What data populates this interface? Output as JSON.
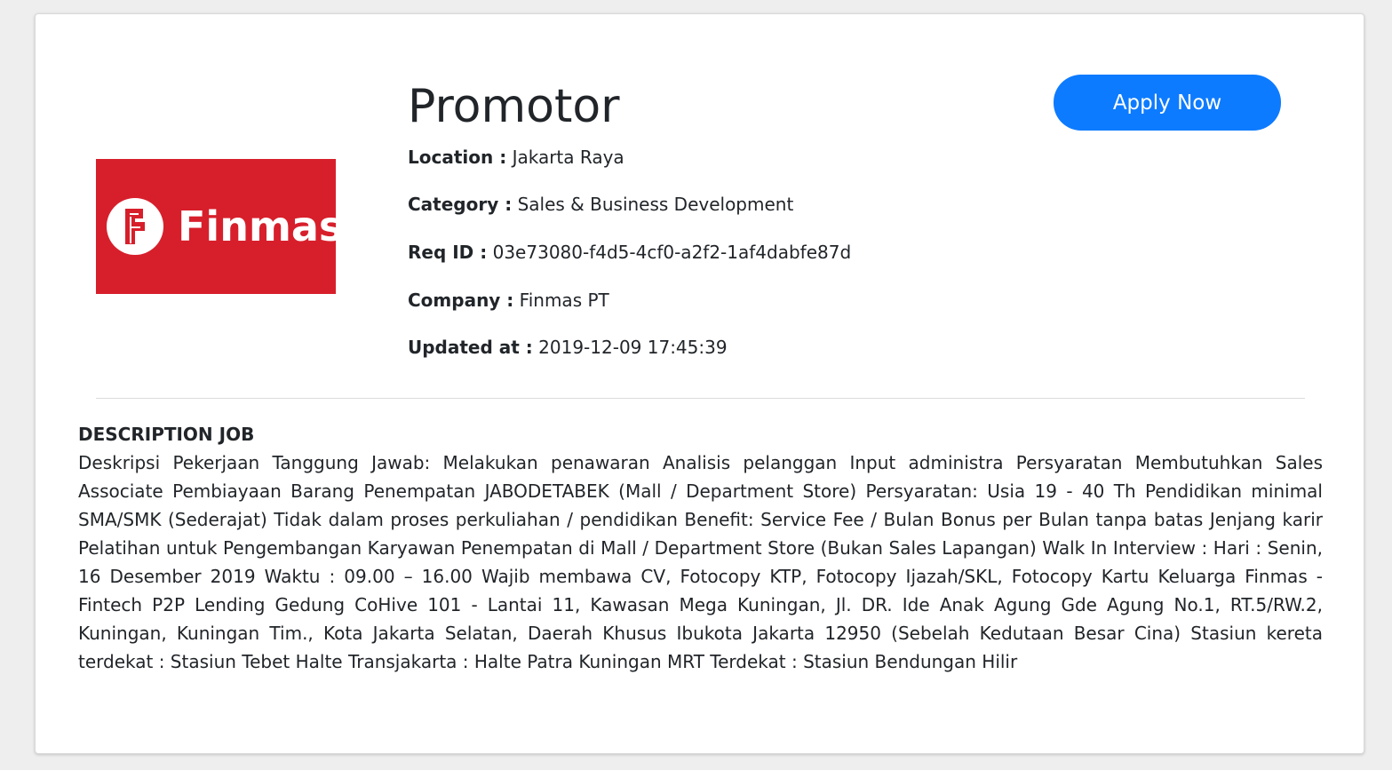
{
  "job": {
    "title": "Promotor",
    "apply_label": "Apply Now",
    "logo_text": "Finmas",
    "fields": {
      "location_label": "Location :",
      "location_value": "Jakarta Raya",
      "category_label": "Category :",
      "category_value": "Sales & Business Development",
      "reqid_label": "Req ID :",
      "reqid_value": "03e73080-f4d5-4cf0-a2f2-1af4dabfe87d",
      "company_label": "Company :",
      "company_value": "Finmas PT",
      "updated_label": "Updated at :",
      "updated_value": "2019-12-09 17:45:39"
    },
    "description_heading": "DESCRIPTION JOB",
    "description_text": "Deskripsi Pekerjaan Tanggung Jawab: Melakukan penawaran Analisis pelanggan Input administra Persyaratan Membutuhkan Sales Associate Pembiayaan Barang Penempatan JABODETABEK (Mall / Department Store) Persyaratan: Usia 19 - 40 Th Pendidikan minimal SMA/SMK (Sederajat) Tidak dalam proses perkuliahan / pendidikan Benefit: Service Fee / Bulan Bonus per Bulan tanpa batas Jenjang karir Pelatihan untuk Pengembangan Karyawan Penempatan di Mall / Department Store (Bukan Sales Lapangan) Walk In Interview : Hari : Senin, 16 Desember 2019 Waktu : 09.00 – 16.00 Wajib membawa CV, Fotocopy KTP, Fotocopy Ijazah/SKL, Fotocopy Kartu Keluarga Finmas - Fintech P2P Lending Gedung CoHive 101 - Lantai 11, Kawasan Mega Kuningan, Jl. DR. Ide Anak Agung Gde Agung No.1, RT.5/RW.2, Kuningan, Kuningan Tim., Kota Jakarta Selatan, Daerah Khusus Ibukota Jakarta 12950 (Sebelah Kedutaan Besar Cina) Stasiun kereta terdekat : Stasiun Tebet Halte Transjakarta : Halte Patra Kuningan MRT Terdekat : Stasiun Bendungan Hilir"
  },
  "colors": {
    "brand_red": "#d71f2b",
    "button_blue": "#0d7bff",
    "text": "#212529"
  }
}
